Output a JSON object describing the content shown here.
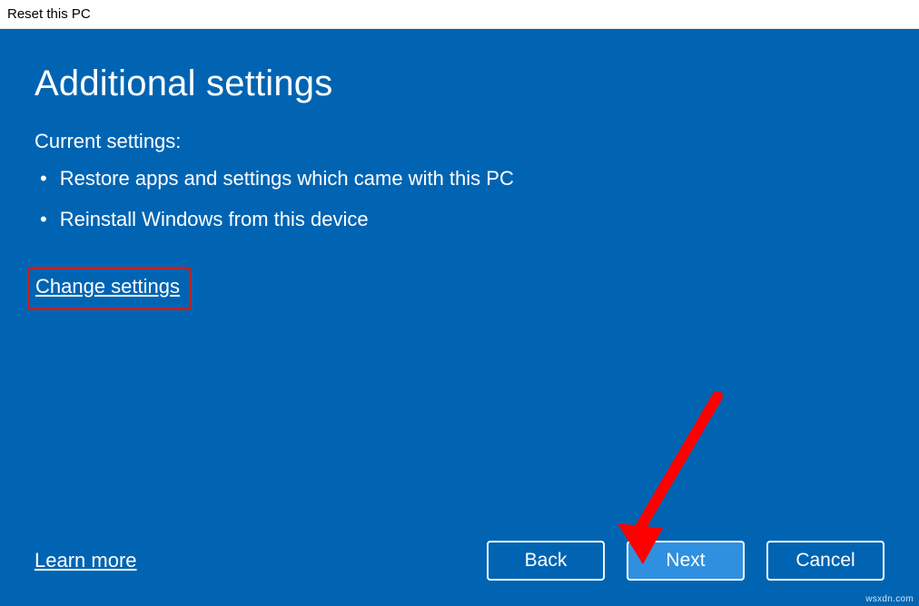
{
  "window": {
    "title": "Reset this PC"
  },
  "main": {
    "heading": "Additional settings",
    "current_settings_label": "Current settings:",
    "items": [
      "Restore apps and settings which came with this PC",
      "Reinstall Windows from this device"
    ],
    "change_settings_link": "Change settings"
  },
  "footer": {
    "learn_more": "Learn more",
    "back": "Back",
    "next": "Next",
    "cancel": "Cancel"
  },
  "watermark": "wsxdn.com"
}
